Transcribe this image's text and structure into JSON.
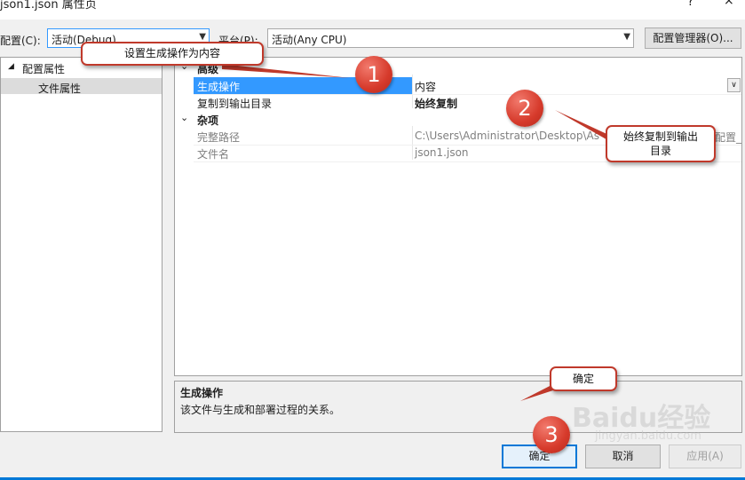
{
  "window": {
    "title": "json1.json 属性页",
    "help": "?",
    "close": "×"
  },
  "config_bar": {
    "config_label": "配置(C):",
    "config_value": "活动(Debug)",
    "platform_label": "平台(P):",
    "platform_value": "活动(Any CPU)",
    "manager_button": "配置管理器(O)..."
  },
  "tree": {
    "root": "配置属性",
    "child": "文件属性"
  },
  "grid": {
    "categories": [
      {
        "label": "高级"
      },
      {
        "label": "杂项"
      }
    ],
    "advanced_rows": [
      {
        "name": "生成操作",
        "value": "内容"
      },
      {
        "name": "复制到输出目录",
        "value": "始终复制"
      }
    ],
    "misc_rows": [
      {
        "name": "完整路径",
        "value": "C:\\Users\\Administrator\\Desktop\\As"
      },
      {
        "name": "文件名",
        "value": "json1.json"
      }
    ],
    "overflow_text": "配置_"
  },
  "description": {
    "title": "生成操作",
    "text": "该文件与生成和部署过程的关系。"
  },
  "buttons": {
    "ok": "确定",
    "cancel": "取消",
    "apply": "应用(A)"
  },
  "annotations": {
    "callout_1": "设置生成操作为内容",
    "callout_2": "始终复制到输出目录",
    "callout_3": "确定",
    "badge_1": "1",
    "badge_2": "2",
    "badge_3": "3"
  },
  "watermark": {
    "logo": "Baidu经验",
    "url": "jingyan.baidu.com"
  },
  "colors": {
    "selection": "#3399ff",
    "focus_border": "#0078d7",
    "annotation_red": "#d63a2b"
  }
}
